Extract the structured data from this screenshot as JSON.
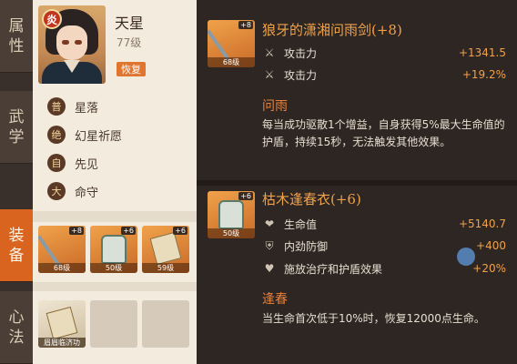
{
  "tabs": [
    {
      "label_1": "属",
      "label_2": "性"
    },
    {
      "label_1": "武",
      "label_2": "学"
    },
    {
      "label_1": "装",
      "label_2": "备"
    },
    {
      "label_1": "心",
      "label_2": "法"
    }
  ],
  "hero": {
    "element": "炎",
    "name": "天星",
    "level": "77级",
    "recover_label": "恢复"
  },
  "skills": [
    {
      "badge": "普",
      "name": "星落"
    },
    {
      "badge": "绝",
      "name": "幻星祈愿"
    },
    {
      "badge": "自",
      "name": "先见"
    },
    {
      "badge": "大",
      "name": "命守"
    }
  ],
  "equipment": [
    {
      "plus": "+8",
      "level": "68级"
    },
    {
      "plus": "+6",
      "level": "50级"
    },
    {
      "plus": "+6",
      "level": "59级"
    }
  ],
  "book": {
    "label": "眉眉临济功"
  },
  "weapon": {
    "thumb_plus": "+8",
    "thumb_level": "68级",
    "title": "狼牙的潇湘问雨剑(+8)",
    "stats": [
      {
        "name": "攻击力",
        "value": "+1341.5"
      },
      {
        "name": "攻击力",
        "value": "+19.2%"
      }
    ],
    "skill_title": "问雨",
    "skill_desc": "每当成功驱散1个增益，自身获得5%最大生命值的护盾，持续15秒，无法触发其他效果。"
  },
  "armor": {
    "thumb_plus": "+6",
    "thumb_level": "50级",
    "title": "枯木逢春衣(+6)",
    "stats": [
      {
        "name": "生命值",
        "value": "+5140.7"
      },
      {
        "name": "内劲防御",
        "value": "+400"
      },
      {
        "name": "施放治疗和护盾效果",
        "value": "+20%"
      }
    ],
    "skill_title": "逢春",
    "skill_desc": "当生命首次低于10%时，恢复12000点生命。"
  }
}
